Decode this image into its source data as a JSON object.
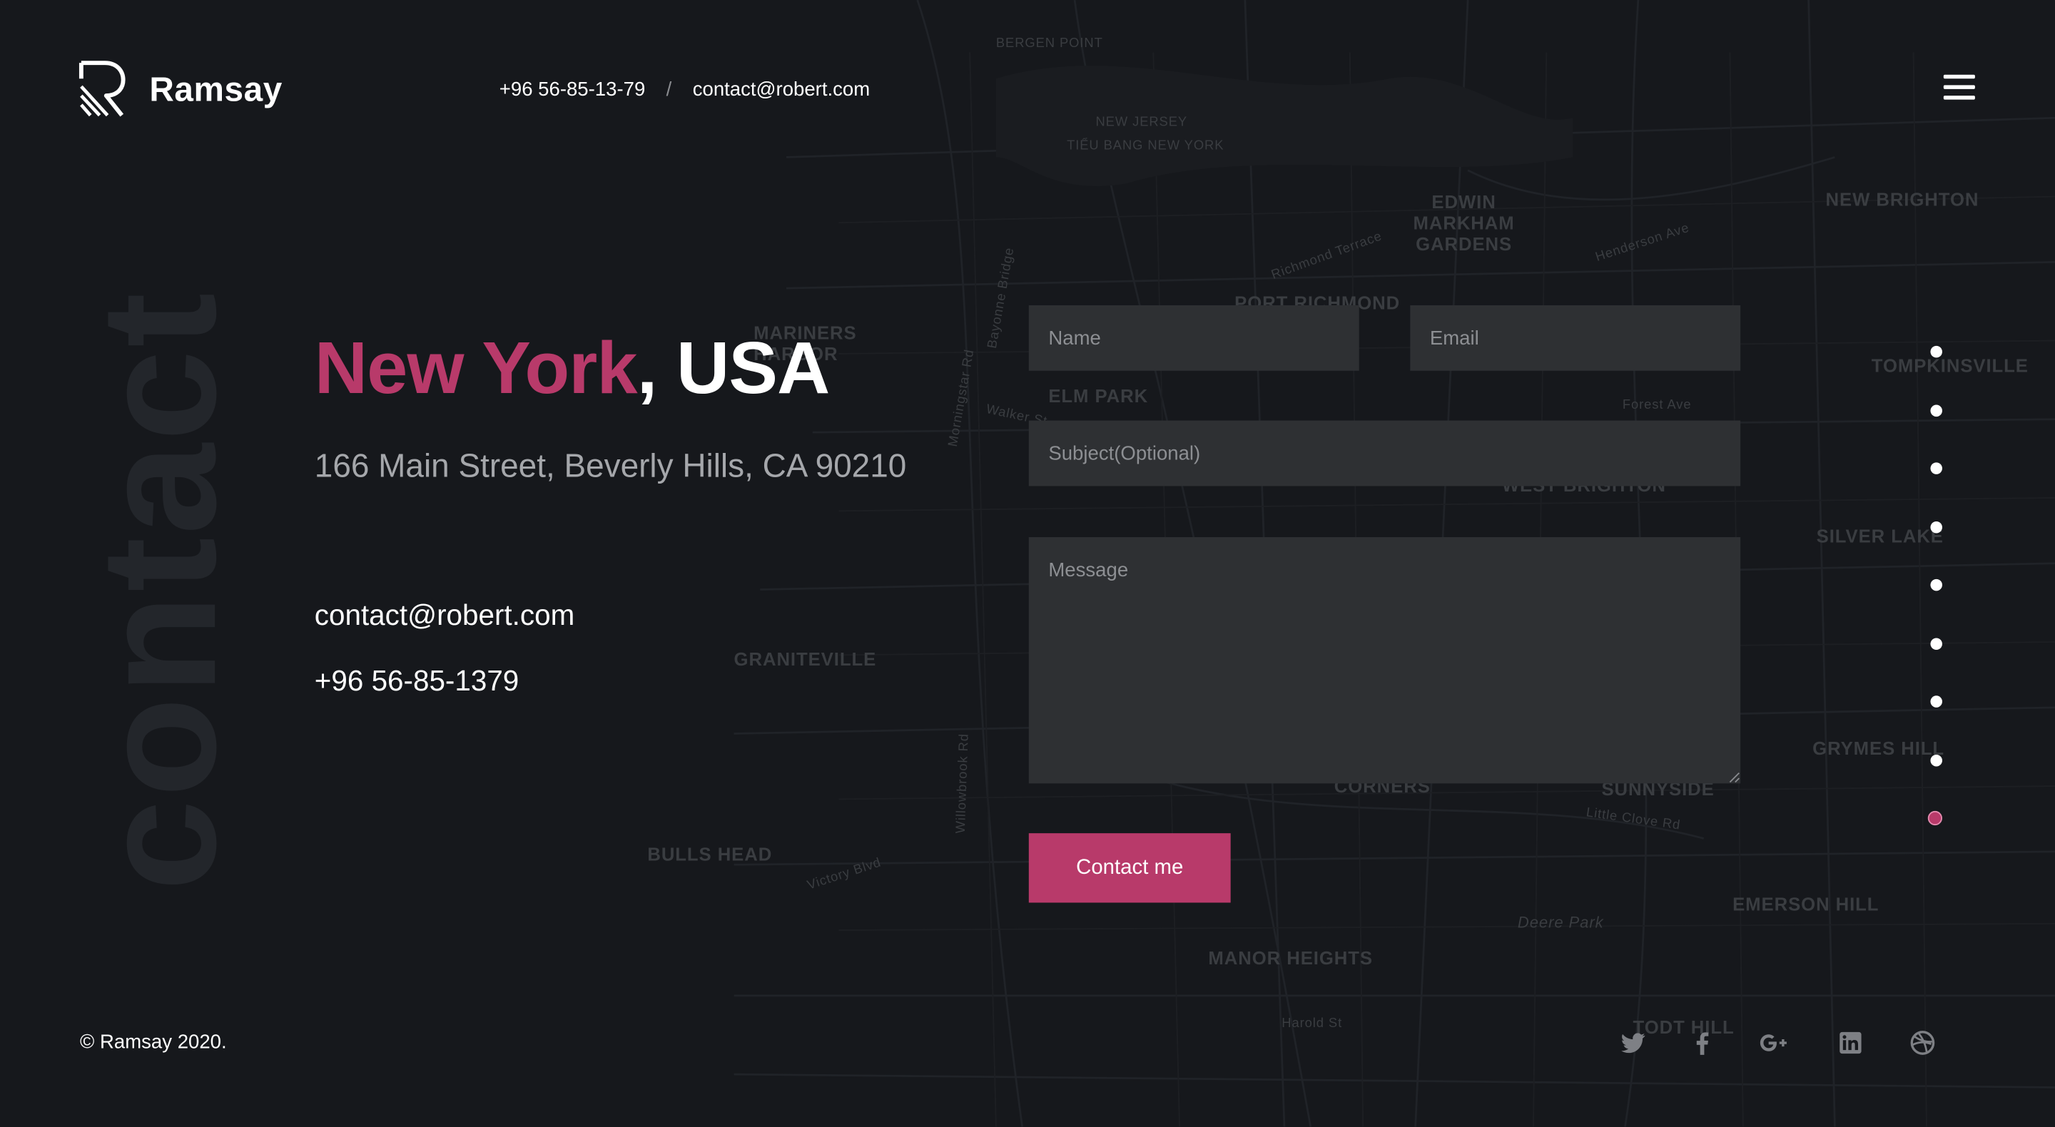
{
  "header": {
    "brand": "Ramsay",
    "phone": "+96 56-85-13-79",
    "separator": "/",
    "email": "contact@robert.com"
  },
  "watermark": "contact",
  "location": {
    "city": "New York",
    "country_suffix": ", USA",
    "address": "166 Main Street, Beverly Hills, CA 90210",
    "email": "contact@robert.com",
    "phone": "+96 56-85-1379"
  },
  "form": {
    "name_placeholder": "Name",
    "email_placeholder": "Email",
    "subject_placeholder": "Subject(Optional)",
    "message_placeholder": "Message",
    "submit_label": "Contact me"
  },
  "pager": {
    "count": 9,
    "active_index": 8
  },
  "footer": {
    "copyright": "© Ramsay 2020.",
    "social": [
      "twitter-icon",
      "facebook-icon",
      "google-plus-icon",
      "linkedin-icon",
      "dribbble-icon"
    ]
  },
  "map_labels": [
    "BERGEN POINT",
    "NEW JERSEY",
    "TIỂU BANG NEW YORK",
    "EDWIN MARKHAM GARDENS",
    "PORT RICHMOND",
    "MARINERS HARBOR",
    "ELM PARK",
    "GRANITEVILLE",
    "BULLS HEAD",
    "MANOR HEIGHTS",
    "EMERSON HILL",
    "SILVER LAKE",
    "GRYMES HILL",
    "TOMPKINSVILLE",
    "NEW BRIGHTON",
    "WEST BRIGHTON",
    "CORNERS",
    "SUNNYSIDE",
    "TODT HILL",
    "Richmond Terrace",
    "Forest Ave",
    "Victory Blvd",
    "Willowbrook Rd",
    "Deere Park",
    "Harold St",
    "Little Clove Rd",
    "Henderson Ave",
    "Bayonne Bridge",
    "Morningstar Rd",
    "Walker St"
  ],
  "colors": {
    "accent": "#b83a6a",
    "background": "#16181c",
    "field": "#2e3033"
  }
}
